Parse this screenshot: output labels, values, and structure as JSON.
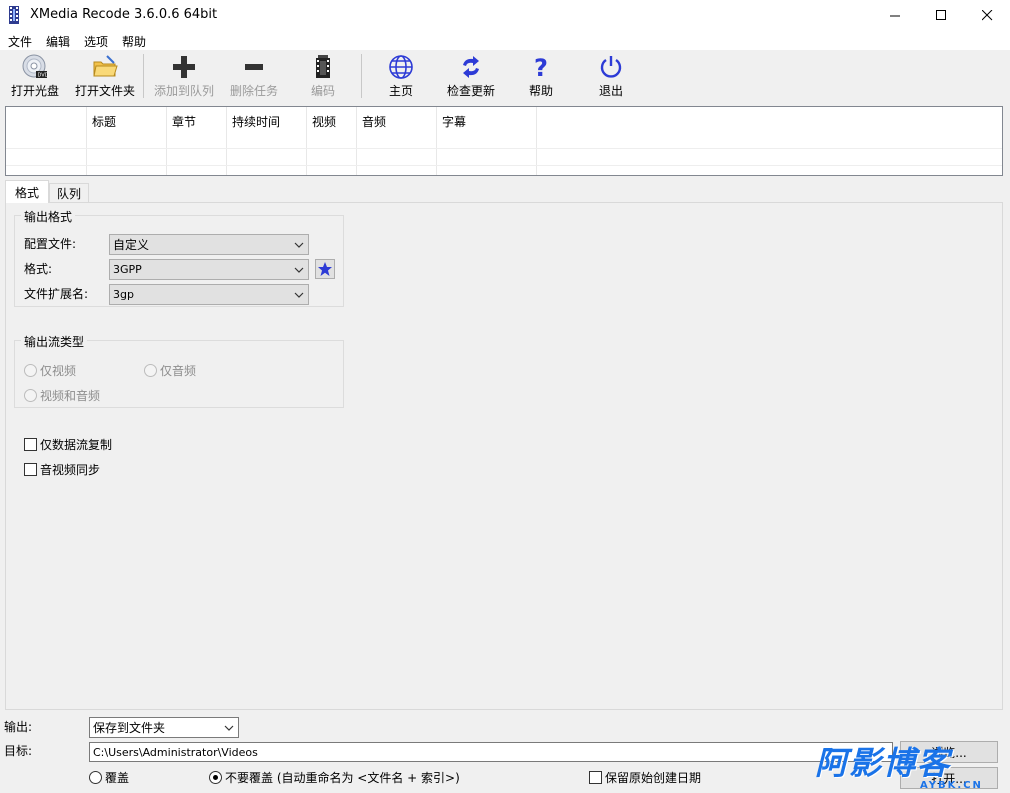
{
  "window": {
    "title": "XMedia Recode 3.6.0.6 64bit"
  },
  "menu": [
    "文件",
    "编辑",
    "选项",
    "帮助"
  ],
  "toolbar": {
    "open_disc": "打开光盘",
    "open_folder": "打开文件夹",
    "add_to_queue": "添加到队列",
    "remove_job": "删除任务",
    "encode": "编码",
    "home": "主页",
    "check_update": "检查更新",
    "help": "帮助",
    "exit": "退出"
  },
  "filelist": {
    "columns": [
      "",
      "标题",
      "章节",
      "持续时间",
      "视频",
      "音频",
      "字幕"
    ]
  },
  "tabs": {
    "format": "格式",
    "queue": "队列"
  },
  "output_format": {
    "group_title": "输出格式",
    "profile_label": "配置文件:",
    "profile_value": "自定义",
    "format_label": "格式:",
    "format_value": "3GPP",
    "extension_label": "文件扩展名:",
    "extension_value": "3gp"
  },
  "stream_type": {
    "group_title": "输出流类型",
    "video_only": "仅视频",
    "audio_only": "仅音频",
    "video_and_audio": "视频和音频"
  },
  "options": {
    "stream_copy": "仅数据流复制",
    "av_sync": "音视频同步"
  },
  "bottom": {
    "output_label": "输出:",
    "output_value": "保存到文件夹",
    "target_label": "目标:",
    "target_value": "C:\\Users\\Administrator\\Videos",
    "browse": "浏览...",
    "overwrite": "覆盖",
    "no_overwrite": "不要覆盖 (自动重命名为 <文件名 + 索引>)",
    "keep_date": "保留原始创建日期",
    "open": "打开..."
  },
  "watermark": {
    "main": "阿影博客",
    "sub": "AYBK.CN"
  },
  "colors": {
    "accent": "#2d3bd6",
    "watermark": "#1a73e8"
  }
}
